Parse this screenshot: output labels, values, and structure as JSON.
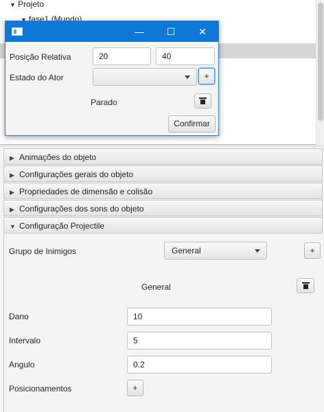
{
  "tree": {
    "root_label": "Projeto",
    "child_label": "fase1 (Mundo)"
  },
  "dialog": {
    "title": "",
    "position_label": "Posição Relativa",
    "position_x": "20",
    "position_y": "40",
    "state_label": "Estado do Ator",
    "state_value": "",
    "add_label": "+",
    "state_name": "Parado",
    "confirm_label": "Confirmar",
    "controls": {
      "minimize": "—",
      "maximize": "☐",
      "close": "✕"
    }
  },
  "accordion": {
    "sections": [
      {
        "label": "Animações do objeto",
        "expanded": false
      },
      {
        "label": "Configurações gerais do objeto",
        "expanded": false
      },
      {
        "label": "Propriedades de dimensão e colisão",
        "expanded": false
      },
      {
        "label": "Configurações dos sons do objeto",
        "expanded": false
      },
      {
        "label": "Configuração Projectile",
        "expanded": true
      }
    ]
  },
  "projectile": {
    "enemy_group_label": "Grupo de Inimigos",
    "enemy_group_value": "General",
    "add_label": "+",
    "group_item": "General",
    "damage_label": "Dano",
    "damage_value": "10",
    "interval_label": "Intervalo",
    "interval_value": "5",
    "angle_label": "Angulo",
    "angle_value": "0.2",
    "positions_label": "Posicionamentos",
    "positions_add_label": "+"
  },
  "colors": {
    "titlebar": "#0d78d6",
    "focus": "#3a95e0",
    "selection": "#d6d6d6"
  }
}
